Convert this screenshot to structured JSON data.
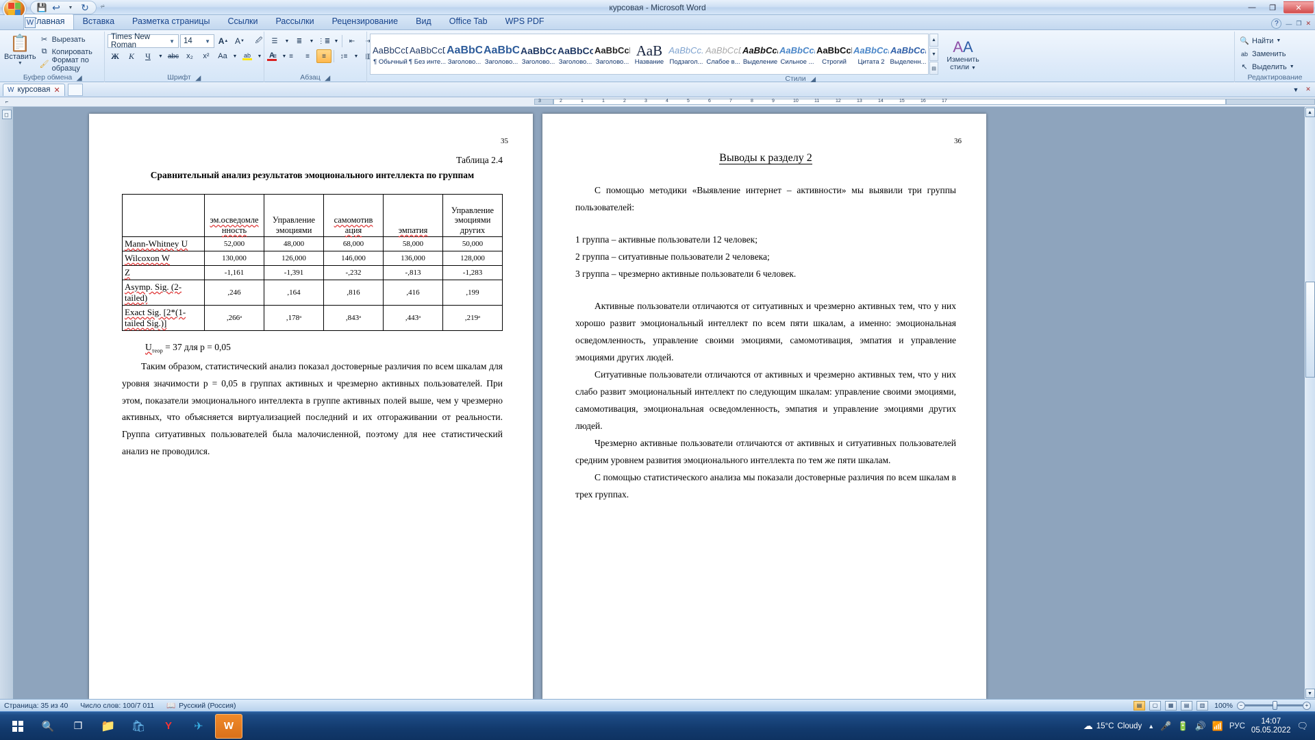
{
  "window": {
    "title": "курсовая - Microsoft Word",
    "minimize": "—",
    "restore": "❐",
    "close": "✕"
  },
  "quick_access": {
    "save": "save-icon",
    "undo": "undo-icon",
    "redo": "redo-icon",
    "customize": "customize-icon"
  },
  "ribbon": {
    "tabs": [
      {
        "label": "Главная",
        "active": true
      },
      {
        "label": "Вставка",
        "active": false
      },
      {
        "label": "Разметка страницы",
        "active": false
      },
      {
        "label": "Ссылки",
        "active": false
      },
      {
        "label": "Рассылки",
        "active": false
      },
      {
        "label": "Рецензирование",
        "active": false
      },
      {
        "label": "Вид",
        "active": false
      },
      {
        "label": "Office Tab",
        "active": false
      },
      {
        "label": "WPS PDF",
        "active": false
      }
    ],
    "groups": {
      "clipboard": {
        "label": "Буфер обмена",
        "paste": "Вставить",
        "cut": "Вырезать",
        "copy": "Копировать",
        "format_painter": "Формат по образцу"
      },
      "font": {
        "label": "Шрифт",
        "font_name": "Times New Roman",
        "font_size": "14",
        "grow": "A▲",
        "shrink": "A▼",
        "clear_format": "Aa",
        "bold": "Ж",
        "italic": "К",
        "underline": "Ч",
        "strike": "abc",
        "subscript": "x₂",
        "superscript": "x²",
        "change_case": "Aa",
        "highlight": "ab",
        "font_color": "A"
      },
      "paragraph": {
        "label": "Абзац",
        "bullets": "bullet-list-icon",
        "numbering": "numbered-list-icon",
        "multilevel": "multilevel-list-icon",
        "decrease_indent": "decrease-indent-icon",
        "increase_indent": "increase-indent-icon",
        "sort": "sort-icon",
        "show_marks": "¶",
        "align_left": "align-left-icon",
        "align_center": "align-center-icon",
        "align_right": "align-right-icon",
        "align_justify": "align-justify-icon",
        "line_spacing": "line-spacing-icon",
        "shading": "shading-icon",
        "borders": "borders-icon"
      },
      "styles": {
        "label": "Стили",
        "items": [
          {
            "preview": "AaBbCcDc",
            "name": "¶ Обычный"
          },
          {
            "preview": "AaBbCcDc",
            "name": "¶ Без инте..."
          },
          {
            "preview": "AaBbC",
            "name": "Заголово..."
          },
          {
            "preview": "AaBbCc",
            "name": "Заголово..."
          },
          {
            "preview": "AaBbCcD",
            "name": "Заголово..."
          },
          {
            "preview": "AaBbCcD",
            "name": "Заголово..."
          },
          {
            "preview": "AaBbCcD",
            "name": "Заголово..."
          },
          {
            "preview": "АаB",
            "name": "Название"
          },
          {
            "preview": "AaBbCc.",
            "name": "Подзагол..."
          },
          {
            "preview": "AaBbCcDi",
            "name": "Слабое в..."
          },
          {
            "preview": "AaBbCcDi",
            "name": "Выделение"
          },
          {
            "preview": "AaBbCcDi",
            "name": "Сильное ..."
          },
          {
            "preview": "AaBbCcDc",
            "name": "Строгий"
          },
          {
            "preview": "AaBbCcDi",
            "name": "Цитата 2"
          },
          {
            "preview": "AaBbCcDi",
            "name": "Выделенн..."
          }
        ],
        "change_styles": "Изменить\nстили"
      },
      "editing": {
        "label": "Редактирование",
        "find": "Найти",
        "replace": "Заменить",
        "select": "Выделить"
      }
    }
  },
  "doc_tabs": {
    "tabs": [
      {
        "label": "курсовая",
        "close": "✕"
      }
    ],
    "new_tab": "+"
  },
  "ruler": {
    "left_marks": [
      "3",
      "2",
      "1",
      "1",
      "2",
      "3",
      "4",
      "5",
      "6",
      "7",
      "8",
      "9",
      "10",
      "11",
      "12",
      "13",
      "14",
      "15",
      "16",
      "17"
    ]
  },
  "document": {
    "left_page": {
      "page_number": "35",
      "table_caption": "Таблица 2.4",
      "table_title": "Сравнительный анализ результатов эмоционального интеллекта по группам",
      "table": {
        "headers": [
          "",
          "эм.осведомле нность",
          "Управление эмоциями",
          "самомотив ация",
          "эмпатия",
          "Управление эмоциями других"
        ],
        "rows": [
          {
            "label": "Mann-Whitney U",
            "values": [
              "52,000",
              "48,000",
              "68,000",
              "58,000",
              "50,000"
            ]
          },
          {
            "label": "Wilcoxon W",
            "values": [
              "130,000",
              "126,000",
              "146,000",
              "136,000",
              "128,000"
            ]
          },
          {
            "label": "Z",
            "values": [
              "-1,161",
              "-1,391",
              "-,232",
              "-,813",
              "-1,283"
            ]
          },
          {
            "label": "Asymp. Sig. (2-tailed)",
            "values": [
              ",246",
              ",164",
              ",816",
              ",416",
              ",199"
            ]
          },
          {
            "label": "Exact Sig. [2*(1-tailed Sig.)]",
            "values": [
              ",266ᵃ",
              ",178ᵃ",
              ",843ᵃ",
              ",443ᵃ",
              ",219ᵃ"
            ]
          }
        ]
      },
      "formula_prefix": "U",
      "formula_sub": "теор",
      "formula_rest": "= 37 для p = 0,05",
      "paragraphs": [
        "Таким образом,  статистический анализ показал достоверные различия по всем шкалам для уровня значимости p = 0,05 в группах активных и чрезмерно активных пользователей. При  этом, показатели эмоционального интеллекта в группе активных полей выше, чем у чрезмерно активных, что объясняется виртуализацией последний и их отгораживании от реальности. Группа ситуативных пользователей была малочисленной, поэтому для нее статистический анализ не проводился."
      ]
    },
    "right_page": {
      "page_number": "36",
      "heading": "Выводы к разделу 2",
      "paragraphs": [
        "С помощью методики «Выявление интернет – активности» мы выявили три группы пользователей:",
        "1 группа – активные пользователи 12 человек;",
        "2 группа – ситуативные пользователи 2 человека;",
        "3 группа – чрезмерно активные пользователи 6 человек.",
        "Активные пользователи отличаются от ситуативных и чрезмерно активных тем, что у них хорошо развит эмоциональный интеллект по всем пяти шкалам, а именно: эмоциональная осведомленность, управление своими эмоциями, самомотивация, эмпатия и управление эмоциями других людей.",
        "Ситуативные пользователи отличаются от активных и чрезмерно активных тем, что у них слабо развит эмоциональный интеллект по следующим шкалам: управление своими эмоциями, самомотивация, эмоциональная осведомленность, эмпатия и управление эмоциями других людей.",
        "Чрезмерно активные пользователи отличаются от активных и ситуативных пользователей средним уровнем развития эмоционального интеллекта по тем же пяти шкалам.",
        "С помощью статистического анализа мы показали достоверные различия по всем шкалам в трех группах."
      ]
    }
  },
  "status_bar": {
    "page_info": "Страница: 35 из 40",
    "word_count": "Число слов: 100/7 011",
    "language": "Русский (Россия)",
    "zoom_level": "100%",
    "zoom_out": "−",
    "zoom_in": "+"
  },
  "taskbar": {
    "start": "start-icon",
    "search": "search-icon",
    "task_view": "task-view-icon",
    "apps": [
      "explorer-icon",
      "store-icon",
      "yandex-icon",
      "telegram-icon",
      "word-icon"
    ],
    "weather": {
      "temp": "15°C",
      "cond": "Cloudy"
    },
    "tray_lang": "РУС",
    "time": "14:07",
    "date": "05.05.2022"
  }
}
